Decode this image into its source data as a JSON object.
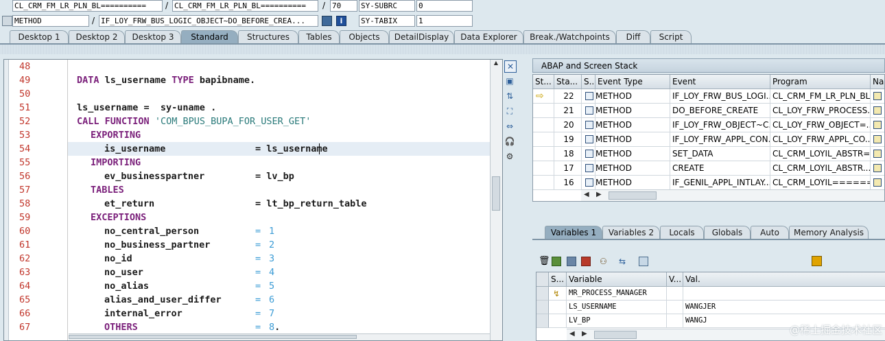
{
  "top_fields": {
    "row1": {
      "program_a": "CL_CRM_FM_LR_PLN_BL==========",
      "program_b": "CL_CRM_FM_LR_PLN_BL==========",
      "line_no": "70",
      "sys_var": "SY-SUBRC",
      "sys_val": "0"
    },
    "row2": {
      "event_type": "METHOD",
      "event": "IF_LOY_FRW_BUS_LOGIC_OBJECT~DO_BEFORE_CREA...",
      "sys_var": "SY-TABIX",
      "sys_val": "1"
    },
    "sep_slash": "/"
  },
  "tabs": [
    {
      "label": "Desktop 1"
    },
    {
      "label": "Desktop 2"
    },
    {
      "label": "Desktop 3"
    },
    {
      "label": "Standard"
    },
    {
      "label": "Structures"
    },
    {
      "label": "Tables"
    },
    {
      "label": "Objects"
    },
    {
      "label": "DetailDisplay"
    },
    {
      "label": "Data Explorer"
    },
    {
      "label": "Break./Watchpoints"
    },
    {
      "label": "Diff"
    },
    {
      "label": "Script"
    }
  ],
  "active_tab": "Standard",
  "editor": {
    "lines": [
      {
        "n": "48"
      },
      {
        "n": "49"
      },
      {
        "n": "50"
      },
      {
        "n": "51"
      },
      {
        "n": "52"
      },
      {
        "n": "53"
      },
      {
        "n": "54"
      },
      {
        "n": "55"
      },
      {
        "n": "56"
      },
      {
        "n": "57"
      },
      {
        "n": "58"
      },
      {
        "n": "59"
      },
      {
        "n": "60"
      },
      {
        "n": "61"
      },
      {
        "n": "62"
      },
      {
        "n": "63"
      },
      {
        "n": "64"
      },
      {
        "n": "65"
      },
      {
        "n": "66"
      },
      {
        "n": "67"
      }
    ],
    "code": {
      "l49_kw1": "DATA",
      "l49_txt": " ls_username ",
      "l49_kw2": "TYPE",
      "l49_txt2": " bapibname.",
      "l51": "ls_username =  sy-uname .",
      "l52_kw": "CALL FUNCTION",
      "l52_str": "'COM_BPUS_BUPA_FOR_USER_GET'",
      "l53": "EXPORTING",
      "l54_a": "is_username",
      "l54_b": "= ls_username",
      "l55": "IMPORTING",
      "l56_a": "ev_businesspartner",
      "l56_b": "= lv_bp",
      "l57": "TABLES",
      "l58_a": "et_return",
      "l58_b": "= lt_bp_return_table",
      "l59": "EXCEPTIONS",
      "exc": [
        {
          "name": "no_central_person",
          "val": "1"
        },
        {
          "name": "no_business_partner",
          "val": "2"
        },
        {
          "name": "no_id",
          "val": "3"
        },
        {
          "name": "no_user",
          "val": "4"
        },
        {
          "name": "no_alias",
          "val": "5"
        },
        {
          "name": "alias_and_user_differ",
          "val": "6"
        },
        {
          "name": "internal_error",
          "val": "7"
        },
        {
          "name": "OTHERS",
          "val": "8"
        }
      ],
      "eq": "=",
      "period": "."
    }
  },
  "stack_panel": {
    "title": "ABAP and Screen Stack",
    "headers": [
      "St...",
      "Sta...",
      "S...",
      "Event Type",
      "Event",
      "Program",
      "Na..."
    ],
    "rows": [
      {
        "level": "22",
        "type": "METHOD",
        "event": "IF_LOY_FRW_BUS_LOGI...",
        "program": "CL_CRM_FM_LR_PLN_BL...",
        "current": true
      },
      {
        "level": "21",
        "type": "METHOD",
        "event": "DO_BEFORE_CREATE",
        "program": "CL_LOY_FRW_PROCESS...",
        "current": false
      },
      {
        "level": "20",
        "type": "METHOD",
        "event": "IF_LOY_FRW_OBJECT~C...",
        "program": "CL_LOY_FRW_OBJECT=...",
        "current": false
      },
      {
        "level": "19",
        "type": "METHOD",
        "event": "IF_LOY_FRW_APPL_CON...",
        "program": "CL_LOY_FRW_APPL_CO...",
        "current": false
      },
      {
        "level": "18",
        "type": "METHOD",
        "event": "SET_DATA",
        "program": "CL_CRM_LOYIL_ABSTR=...",
        "current": false
      },
      {
        "level": "17",
        "type": "METHOD",
        "event": "CREATE",
        "program": "CL_CRM_LOYIL_ABSTR...",
        "current": false
      },
      {
        "level": "16",
        "type": "METHOD",
        "event": "IF_GENIL_APPL_INTLAY...",
        "program": "CL_CRM_LOYIL=======...",
        "current": false
      }
    ]
  },
  "var_tabs": [
    {
      "label": "Variables 1"
    },
    {
      "label": "Variables 2"
    },
    {
      "label": "Locals"
    },
    {
      "label": "Globals"
    },
    {
      "label": "Auto"
    },
    {
      "label": "Memory Analysis"
    }
  ],
  "active_var_tab": "Variables 1",
  "var_grid": {
    "headers": [
      "S...",
      "Variable",
      "V...",
      "Val."
    ],
    "rows": [
      {
        "name": "MR_PROCESS_MANAGER",
        "value": "",
        "icon": true
      },
      {
        "name": "LS_USERNAME",
        "value": "WANGJER",
        "icon": false
      },
      {
        "name": "LV_BP",
        "value": "WANGJ",
        "icon": false
      }
    ]
  },
  "watermark": "@稀土掘金技术社区"
}
